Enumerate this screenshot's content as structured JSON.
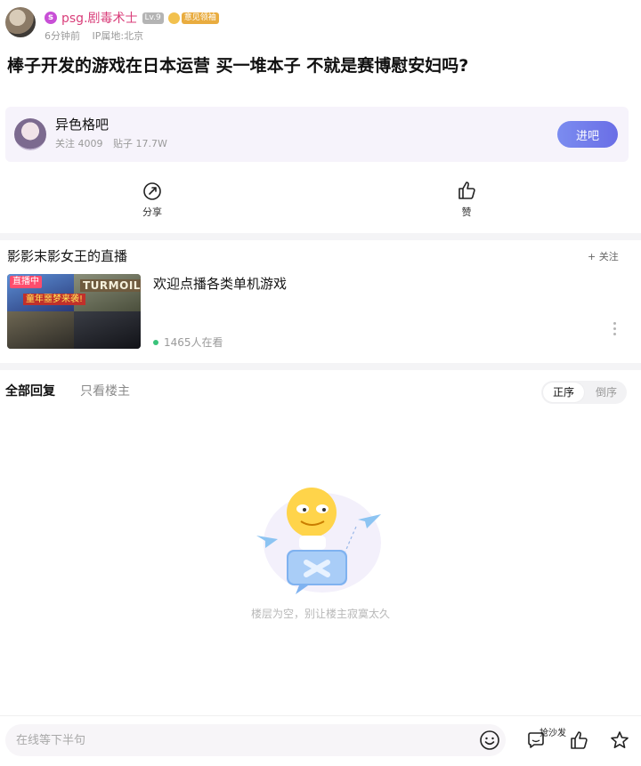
{
  "post": {
    "author": "psg.剧毒术士",
    "author_badge_letter": "s",
    "level": "Lv.9",
    "medal": "意见领袖",
    "time_ago": "6分钟前",
    "ip_location": "IP属地:北京",
    "title": "棒子开发的游戏在日本运营 买一堆本子 不就是赛博慰安妇吗?"
  },
  "forum": {
    "name": "异色格吧",
    "followers": "关注 4009",
    "posts": "贴子 17.7W",
    "enter_label": "进吧"
  },
  "actions": {
    "share_label": "分享",
    "like_label": "赞"
  },
  "live": {
    "section_title": "影影末影女王的直播",
    "follow_label": "+ 关注",
    "badge": "直播中",
    "thumb_text_1": "TURMOIL",
    "thumb_text_2": "童年噩梦来袭!",
    "description": "欢迎点播各类单机游戏",
    "viewers": "1465人在看"
  },
  "tabs": {
    "all_replies": "全部回复",
    "op_only": "只看楼主",
    "sort_asc": "正序",
    "sort_desc": "倒序"
  },
  "empty_state": {
    "text": "楼层为空，别让楼主寂寞太久"
  },
  "bottom": {
    "input_placeholder": "在线等下半句",
    "sofa_label": "抢沙发"
  },
  "colors": {
    "accent": "#6a6ee6",
    "username": "#d93e7a",
    "live_badge": "#ff4d6d",
    "online_dot": "#39c37a"
  }
}
